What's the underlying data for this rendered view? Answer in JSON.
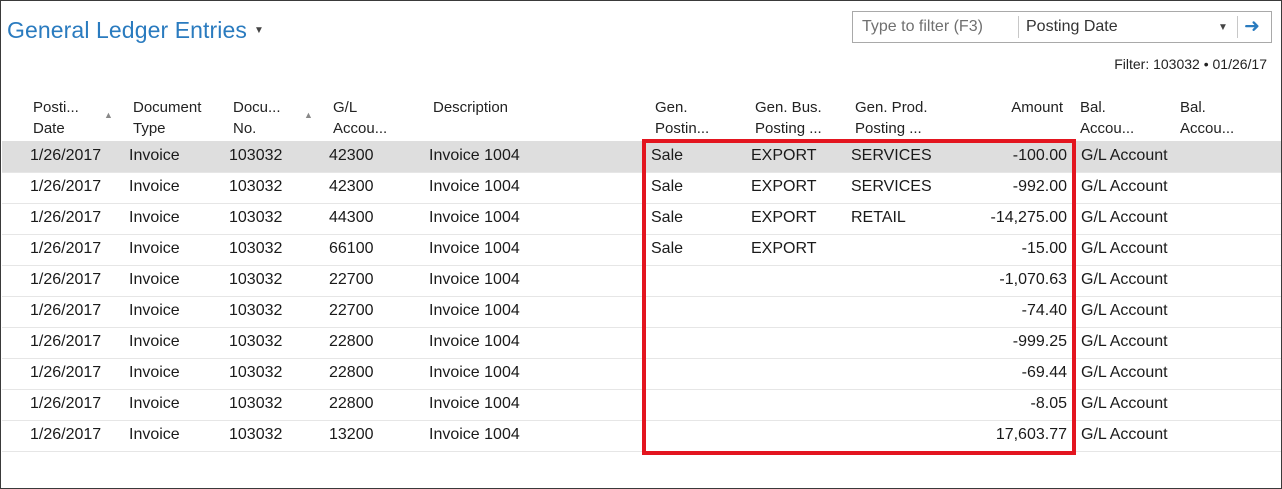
{
  "page": {
    "title": "General Ledger Entries"
  },
  "filter": {
    "placeholder": "Type to filter (F3)",
    "field": "Posting Date",
    "status": "Filter: 103032 • 01/26/17"
  },
  "columns": [
    {
      "line1": "Posti...",
      "line2": "Date"
    },
    {
      "line1": "Document",
      "line2": "Type"
    },
    {
      "line1": "Docu...",
      "line2": "No."
    },
    {
      "line1": "G/L",
      "line2": "Accou..."
    },
    {
      "line1": "Description",
      "line2": ""
    },
    {
      "line1": "Gen.",
      "line2": "Postin..."
    },
    {
      "line1": "Gen. Bus.",
      "line2": "Posting ..."
    },
    {
      "line1": "Gen. Prod.",
      "line2": "Posting ..."
    },
    {
      "line1": "Amount",
      "line2": ""
    },
    {
      "line1": "Bal.",
      "line2": "Accou..."
    },
    {
      "line1": "Bal.",
      "line2": "Accou..."
    }
  ],
  "rows": [
    {
      "date": "1/26/2017",
      "doctype": "Invoice",
      "docno": "103032",
      "gl": "42300",
      "desc": "Invoice 1004",
      "genpost": "Sale",
      "genbus": "EXPORT",
      "genprod": "SERVICES",
      "amount": "-100.00",
      "balacct": "G/L Account",
      "selected": true
    },
    {
      "date": "1/26/2017",
      "doctype": "Invoice",
      "docno": "103032",
      "gl": "42300",
      "desc": "Invoice 1004",
      "genpost": "Sale",
      "genbus": "EXPORT",
      "genprod": "SERVICES",
      "amount": "-992.00",
      "balacct": "G/L Account",
      "selected": false
    },
    {
      "date": "1/26/2017",
      "doctype": "Invoice",
      "docno": "103032",
      "gl": "44300",
      "desc": "Invoice 1004",
      "genpost": "Sale",
      "genbus": "EXPORT",
      "genprod": "RETAIL",
      "amount": "-14,275.00",
      "balacct": "G/L Account",
      "selected": false
    },
    {
      "date": "1/26/2017",
      "doctype": "Invoice",
      "docno": "103032",
      "gl": "66100",
      "desc": "Invoice 1004",
      "genpost": "Sale",
      "genbus": "EXPORT",
      "genprod": "",
      "amount": "-15.00",
      "balacct": "G/L Account",
      "selected": false
    },
    {
      "date": "1/26/2017",
      "doctype": "Invoice",
      "docno": "103032",
      "gl": "22700",
      "desc": "Invoice 1004",
      "genpost": "",
      "genbus": "",
      "genprod": "",
      "amount": "-1,070.63",
      "balacct": "G/L Account",
      "selected": false
    },
    {
      "date": "1/26/2017",
      "doctype": "Invoice",
      "docno": "103032",
      "gl": "22700",
      "desc": "Invoice 1004",
      "genpost": "",
      "genbus": "",
      "genprod": "",
      "amount": "-74.40",
      "balacct": "G/L Account",
      "selected": false
    },
    {
      "date": "1/26/2017",
      "doctype": "Invoice",
      "docno": "103032",
      "gl": "22800",
      "desc": "Invoice 1004",
      "genpost": "",
      "genbus": "",
      "genprod": "",
      "amount": "-999.25",
      "balacct": "G/L Account",
      "selected": false
    },
    {
      "date": "1/26/2017",
      "doctype": "Invoice",
      "docno": "103032",
      "gl": "22800",
      "desc": "Invoice 1004",
      "genpost": "",
      "genbus": "",
      "genprod": "",
      "amount": "-69.44",
      "balacct": "G/L Account",
      "selected": false
    },
    {
      "date": "1/26/2017",
      "doctype": "Invoice",
      "docno": "103032",
      "gl": "22800",
      "desc": "Invoice 1004",
      "genpost": "",
      "genbus": "",
      "genprod": "",
      "amount": "-8.05",
      "balacct": "G/L Account",
      "selected": false
    },
    {
      "date": "1/26/2017",
      "doctype": "Invoice",
      "docno": "103032",
      "gl": "13200",
      "desc": "Invoice 1004",
      "genpost": "",
      "genbus": "",
      "genprod": "",
      "amount": "17,603.77",
      "balacct": "G/L Account",
      "selected": false
    }
  ],
  "colors": {
    "title": "#2a7bbf",
    "highlight_box": "#e3151f",
    "selected_row": "#dedede"
  },
  "icons": {
    "title_menu": "caret-down-icon",
    "sort": "sort-up-icon",
    "filter_dropdown": "chevron-down-icon",
    "filter_apply": "arrow-right-icon"
  }
}
